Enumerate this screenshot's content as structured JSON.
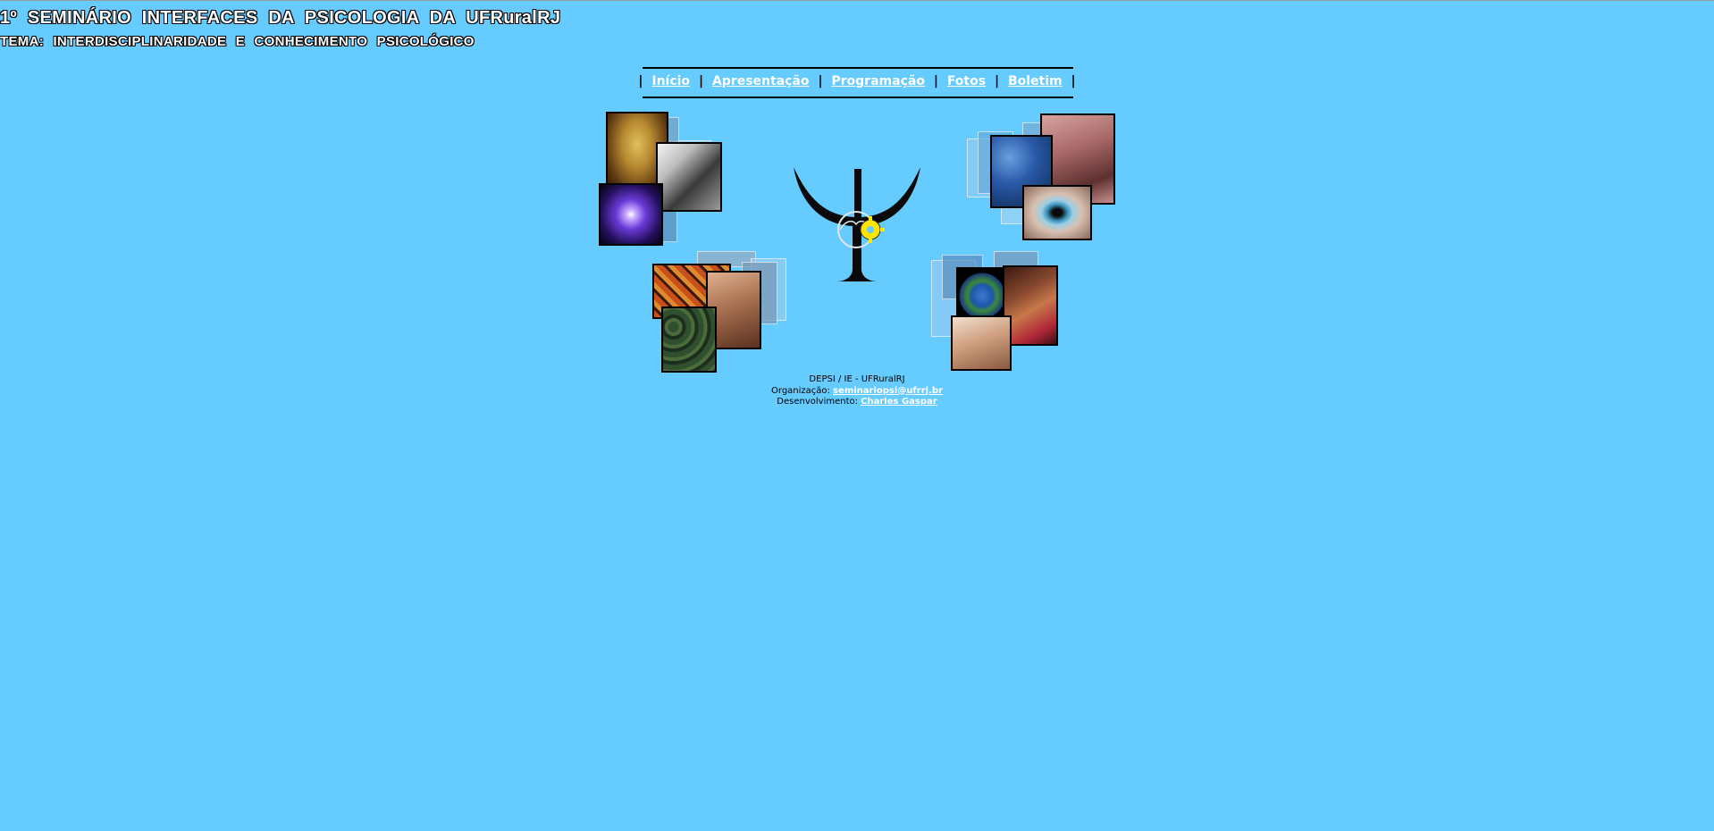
{
  "header": {
    "title": "1º SEMINÁRIO INTERFACES DA PSICOLOGIA DA UFRuralRJ",
    "subtitle": "TEMA: INTERDISCIPLINARIDADE E CONHECIMENTO PSICOLÓGICO"
  },
  "nav": {
    "items": [
      {
        "label": "Início"
      },
      {
        "label": "Apresentação"
      },
      {
        "label": "Programação"
      },
      {
        "label": "Fotos"
      },
      {
        "label": "Boletim"
      }
    ],
    "separator": "|"
  },
  "colors": {
    "background": "#66ccff",
    "link": "#ffffff"
  },
  "icons": [
    "psi-logo-icon",
    "gear-brain-icon"
  ],
  "footer": {
    "dept": "DEPSI / IE - UFRuralRJ",
    "org_label": "Organização:",
    "org_email": "seminariopsi@ufrrj.br",
    "dev_label": "Desenvolvimento:",
    "dev_name": "Charles Gaspar"
  }
}
